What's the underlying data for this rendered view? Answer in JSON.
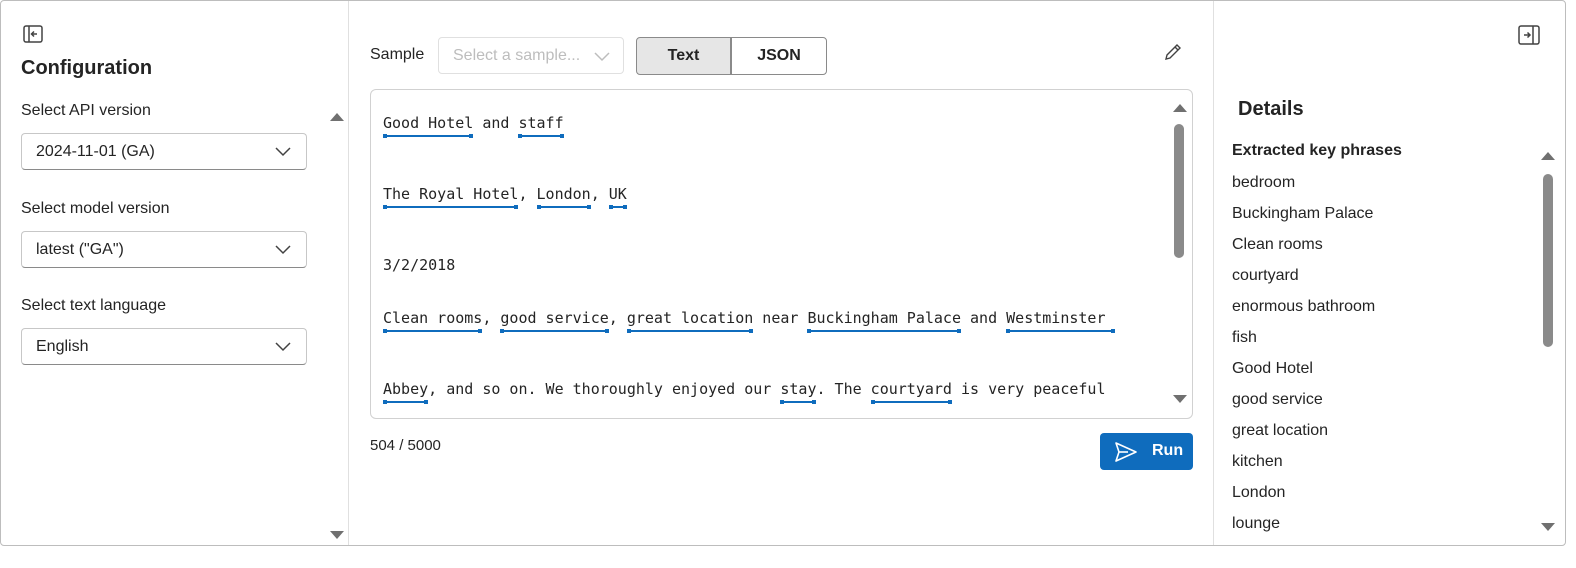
{
  "config": {
    "title": "Configuration",
    "api_label": "Select API version",
    "api_value": "2024-11-01 (GA)",
    "model_label": "Select model version",
    "model_value": "latest (\"GA\")",
    "language_label": "Select text language",
    "language_value": "English"
  },
  "toolbar": {
    "sample_label": "Sample",
    "sample_placeholder": "Select a sample...",
    "text_tab": "Text",
    "json_tab": "JSON"
  },
  "editor": {
    "line1": {
      "p1": "Good Hotel",
      "p2": " and ",
      "p3": "staff"
    },
    "line2": {
      "p1": "The Royal Hotel",
      "p2": ", ",
      "p3": "London",
      "p4": ", ",
      "p5": "UK"
    },
    "line3": "3/2/2018",
    "line4": {
      "p1": "Clean rooms",
      "p2": ", ",
      "p3": "good service",
      "p4": ", ",
      "p5": "great location",
      "p6": " near ",
      "p7": "Buckingham Palace",
      "p8": " and ",
      "p9": "Westminster "
    },
    "line5": {
      "p1": "Abbey",
      "p2": ", and so on. We thoroughly enjoyed our ",
      "p3": "stay",
      "p4": ". The ",
      "p5": "courtyard",
      "p6": " is very peaceful"
    }
  },
  "footer": {
    "char_count": "504 / 5000",
    "run_label": "Run"
  },
  "details": {
    "title": "Details",
    "header": "Extracted key phrases",
    "phrases": [
      "bedroom",
      "Buckingham Palace",
      "Clean rooms",
      "courtyard",
      "enormous bathroom",
      "fish",
      "Good Hotel",
      "good service",
      "great location",
      "kitchen",
      "London",
      "lounge"
    ]
  },
  "colors": {
    "accent": "#0f6cbd"
  },
  "icons": [
    "panel-collapse-left-icon",
    "chevron-down-icon",
    "edit-pencil-icon",
    "send-icon",
    "panel-collapse-right-icon"
  ]
}
